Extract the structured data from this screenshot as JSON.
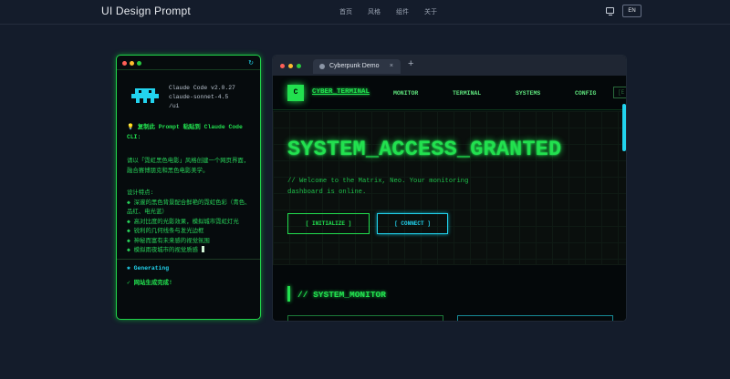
{
  "header": {
    "brand": "UI Design Prompt",
    "nav": [
      "首页",
      "风格",
      "组件",
      "关于"
    ],
    "lang": "EN"
  },
  "terminal": {
    "meta": [
      "Claude Code v2.0.27",
      "claude-sonnet-4.5",
      "/ui"
    ],
    "command": "💡 复制此 Prompt 粘贴到 Claude Code CLI:",
    "description": "请以「霓虹黑色电影」风格创建一个网页界面，融合赛博朋克和黑色电影美学。",
    "features_title": "设计特点:",
    "features": [
      "◆ 深邃的黑色背景配合鲜艳的霓虹色彩（青色、品红、电光蓝）",
      "◆ 高对比度的光影效果，模拟城市霓虹灯光",
      "◆ 锐利的几何线条与发光边框",
      "◆ 神秘而富有未来感的视觉氛围",
      "◆ 模拟雨夜城市的视觉质感"
    ],
    "status_generating": "✱ Generating",
    "status_done": "✓ 网站生成完成!",
    "colors": {
      "green": "#22e04f",
      "cyan": "#22d3ee"
    }
  },
  "browser": {
    "tab_title": "Cyberpunk Demo",
    "tab_close": "×",
    "new_tab": "+",
    "site": {
      "logo_letter": "C",
      "title": "CYBER_TERMINAL",
      "nav": [
        "MONITOR",
        "TERMINAL",
        "SYSTEMS",
        "CONFIG"
      ],
      "chip": "[E",
      "hero_title": "SYSTEM_ACCESS_GRANTED",
      "hero_sub": "// Welcome to the Matrix, Neo. Your monitoring dashboard is online.",
      "btn_initialize": "[ INITIALIZE ]",
      "btn_connect": "[ CONNECT ]",
      "section_title": "// SYSTEM_MONITOR"
    }
  }
}
